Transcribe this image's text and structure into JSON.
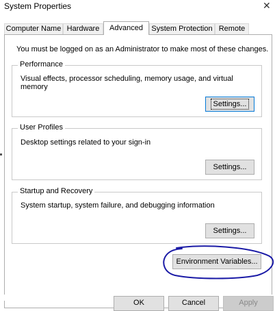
{
  "window": {
    "title": "System Properties",
    "close_glyph": "✕"
  },
  "tabs": [
    {
      "label": "Computer Name",
      "active": false
    },
    {
      "label": "Hardware",
      "active": false
    },
    {
      "label": "Advanced",
      "active": true
    },
    {
      "label": "System Protection",
      "active": false
    },
    {
      "label": "Remote",
      "active": false
    }
  ],
  "admin_note": "You must be logged on as an Administrator to make most of these changes.",
  "groups": {
    "performance": {
      "label": "Performance",
      "description": "Visual effects, processor scheduling, memory usage, and virtual memory",
      "button": "Settings..."
    },
    "user_profiles": {
      "label": "User Profiles",
      "description": "Desktop settings related to your sign-in",
      "button": "Settings..."
    },
    "startup_recovery": {
      "label": "Startup and Recovery",
      "description": "System startup, system failure, and debugging information",
      "button": "Settings..."
    }
  },
  "env_button": "Environment Variables...",
  "bottom_buttons": {
    "ok": "OK",
    "cancel": "Cancel",
    "apply": "Apply"
  },
  "colors": {
    "annotation": "#1a1aa6",
    "focus": "#0078d7"
  }
}
